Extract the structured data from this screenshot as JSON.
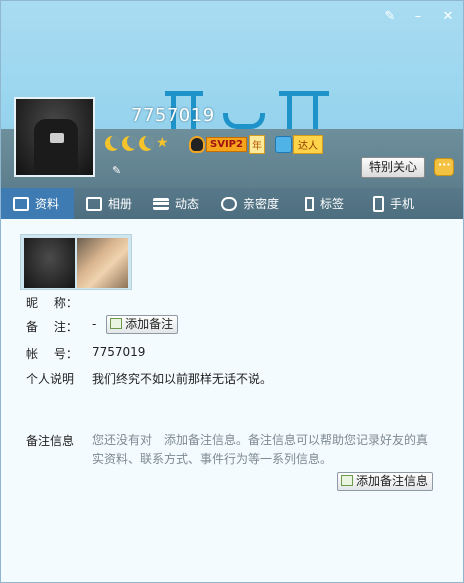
{
  "header": {
    "user_id": "7757019",
    "svip_label": "SVIP2",
    "svip_year": "年",
    "daren_label": "达人",
    "care_button": "特别关心",
    "window_controls": [
      "skin-icon",
      "minimize-icon",
      "close-icon"
    ]
  },
  "tabs": [
    {
      "label": "资料",
      "icon": "profile-card-icon",
      "active": true
    },
    {
      "label": "相册",
      "icon": "album-icon",
      "active": false
    },
    {
      "label": "动态",
      "icon": "feed-list-icon",
      "active": false
    },
    {
      "label": "亲密度",
      "icon": "heart-icon",
      "active": false
    },
    {
      "label": "标签",
      "icon": "bookmark-icon",
      "active": false
    },
    {
      "label": "手机",
      "icon": "phone-icon",
      "active": false
    }
  ],
  "profile": {
    "nickname_label": "昵　 称：",
    "nickname_value": "",
    "remark_label": "备　 注：",
    "remark_value": "-",
    "add_remark_button": "添加备注",
    "account_label": "帐　 号：",
    "account_value": "7757019",
    "bio_label": "个人说明",
    "bio_value": "我们终究不如以前那样无话不说。",
    "remark_info_label": "备注信息",
    "remark_info_text": "您还没有对　添加备注信息。备注信息可以帮助您记录好友的真实资料、联系方式、事件行为等一系列信息。",
    "add_remark_info_button": "添加备注信息"
  },
  "colors": {
    "banner_sky": "#98d4ee",
    "band": "#5d7e8c",
    "tabbar": "#4d6e7f",
    "active_tab": "#3e7bb2",
    "content_bg": "#f4fbfe"
  }
}
